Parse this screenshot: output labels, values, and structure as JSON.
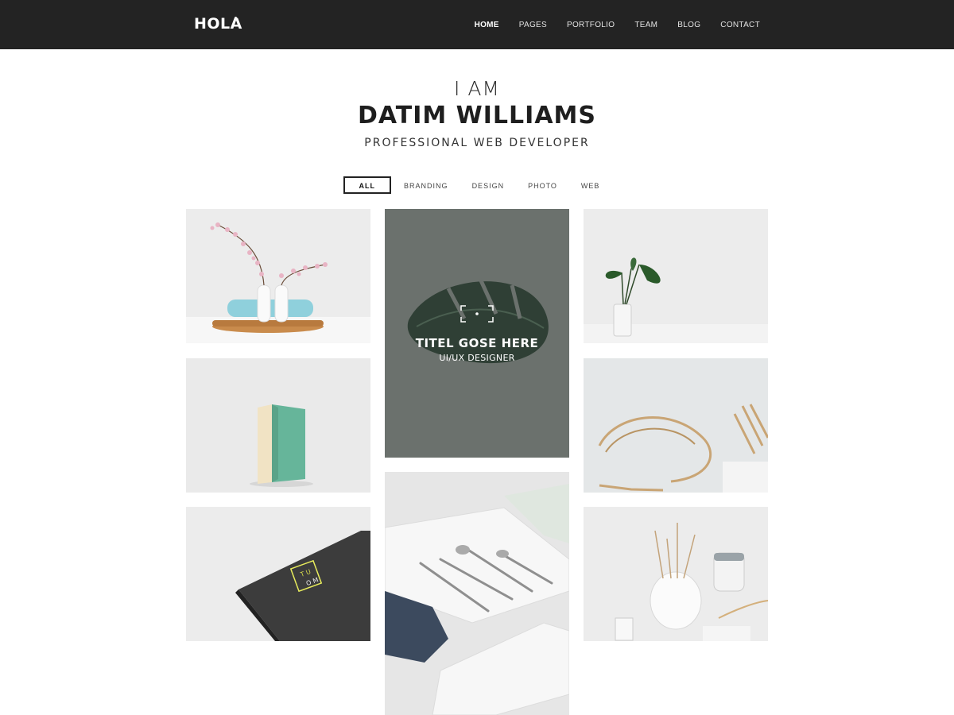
{
  "header": {
    "logo": "HOLA",
    "nav": [
      "HOME",
      "PAGES",
      "PORTFOLIO",
      "TEAM",
      "BLOG",
      "CONTACT"
    ]
  },
  "hero": {
    "pre": "I AM",
    "name": "DATIM WILLIAMS",
    "role": "PROFESSIONAL WEB DEVELOPER"
  },
  "filters": [
    "ALL",
    "BRANDING",
    "DESIGN",
    "PHOTO",
    "WEB"
  ],
  "featured": {
    "title": "TITEL GOSE HERE",
    "subtitle": "UI/UX DESIGNER"
  },
  "colors": {
    "header_bg": "#232323",
    "tile_bg": "#eeeeee",
    "featured_bg": "#6b716d"
  }
}
